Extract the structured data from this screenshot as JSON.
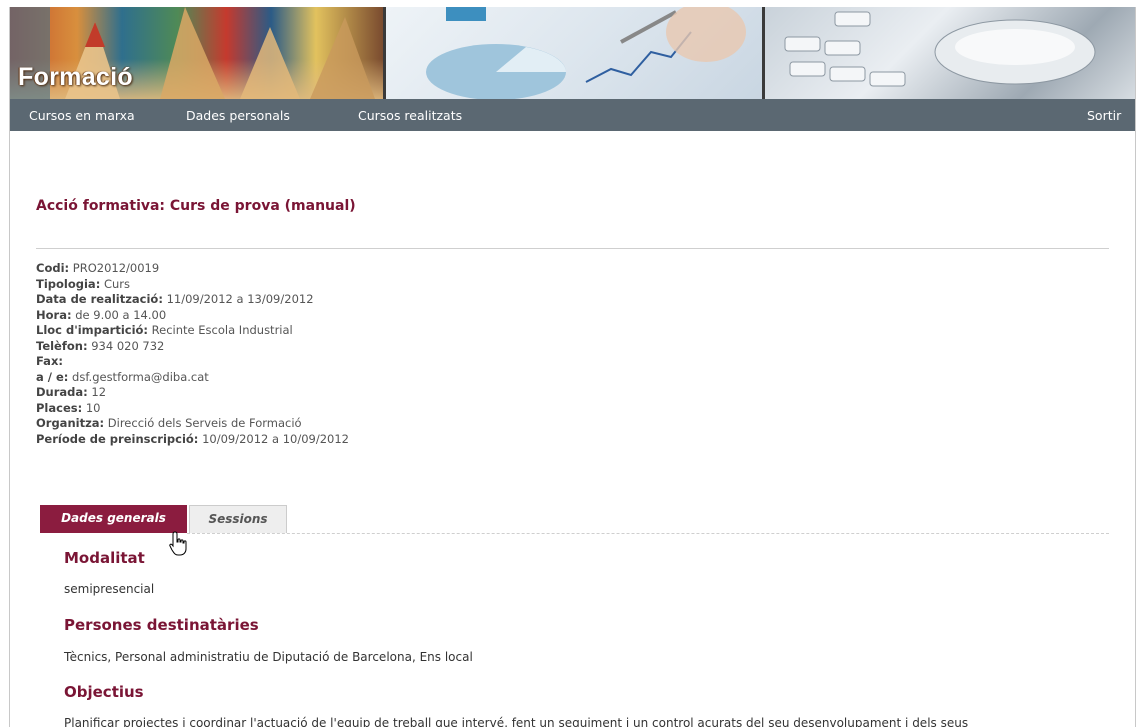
{
  "brand": {
    "title": "Formació"
  },
  "nav": {
    "items": [
      "Cursos en marxa",
      "Dades personals",
      "Cursos realitzats"
    ],
    "logout": "Sortir"
  },
  "course": {
    "title": "Acció formativa: Curs de prova (manual)",
    "fields": [
      {
        "label": "Codi:",
        "value": " PRO2012/0019"
      },
      {
        "label": "Tipologia:",
        "value": " Curs"
      },
      {
        "label": "Data de realització:",
        "value": " 11/09/2012 a 13/09/2012"
      },
      {
        "label": "Hora:",
        "value": " de 9.00 a 14.00"
      },
      {
        "label": "Lloc d'impartició:",
        "value": " Recinte Escola Industrial"
      },
      {
        "label": "Telèfon:",
        "value": " 934 020 732"
      },
      {
        "label": "Fax:",
        "value": ""
      },
      {
        "label": "a / e:",
        "value": " dsf.gestforma@diba.cat"
      },
      {
        "label": "Durada:",
        "value": " 12"
      },
      {
        "label": "Places:",
        "value": " 10"
      },
      {
        "label": "Organitza:",
        "value": " Direcció dels Serveis de Formació"
      },
      {
        "label": "Període de preinscripció:",
        "value": " 10/09/2012 a 10/09/2012"
      }
    ]
  },
  "tabs": [
    "Dades generals",
    "Sessions"
  ],
  "sections": [
    {
      "heading": "Modalitat",
      "text": "semipresencial"
    },
    {
      "heading": "Persones destinatàries",
      "text": "Tècnics, Personal administratiu de Diputació de Barcelona, Ens local"
    },
    {
      "heading": "Objectius",
      "text": "Planificar projectes i coordinar l'actuació de l'equip de treball que intervé, fent un seguiment i un control acurats del seu desenvolupament i dels seus"
    }
  ],
  "colors": {
    "accent": "#8b1c3f",
    "nav_bg": "#5b6872"
  }
}
